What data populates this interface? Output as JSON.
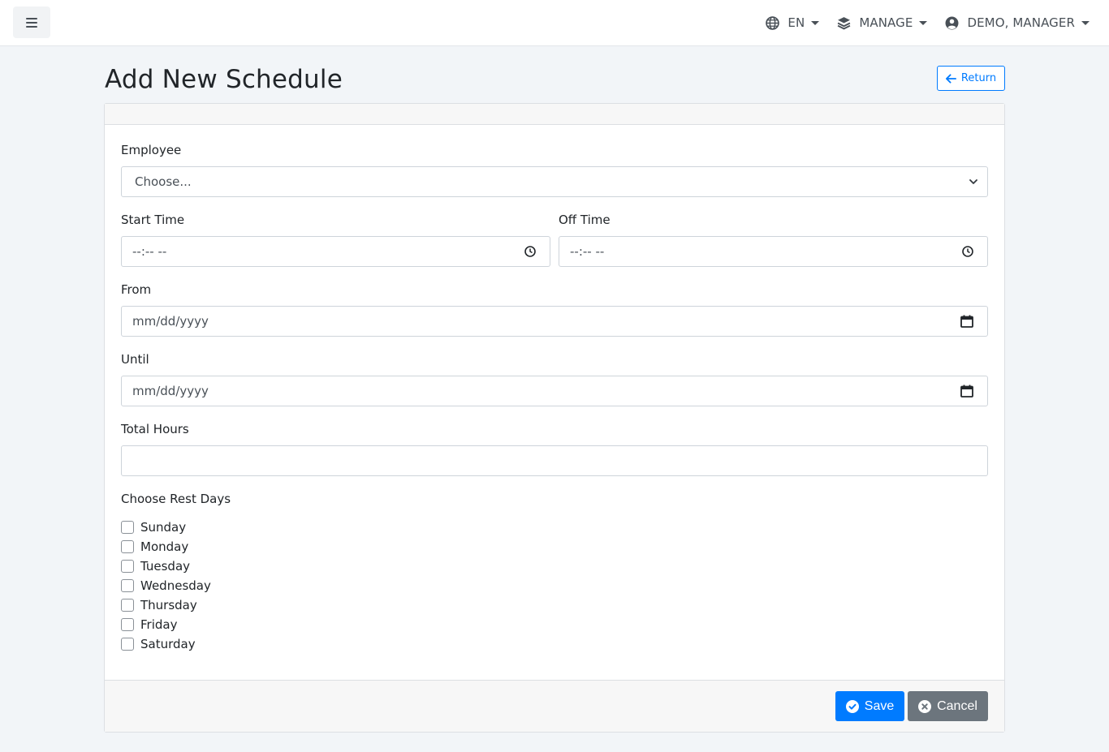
{
  "navbar": {
    "language": "EN",
    "manage": "MANAGE",
    "user": "DEMO, MANAGER"
  },
  "page": {
    "title": "Add New Schedule",
    "return_label": "Return"
  },
  "form": {
    "employee_label": "Employee",
    "employee_value": "Choose...",
    "start_time_label": "Start Time",
    "start_time_value": "--:-- --",
    "off_time_label": "Off Time",
    "off_time_value": "--:-- --",
    "from_label": "From",
    "from_value": "mm/dd/yyyy",
    "until_label": "Until",
    "until_value": "mm/dd/yyyy",
    "total_hours_label": "Total Hours",
    "total_hours_value": "",
    "rest_days_label": "Choose Rest Days",
    "rest_days": [
      {
        "label": "Sunday",
        "checked": false
      },
      {
        "label": "Monday",
        "checked": false
      },
      {
        "label": "Tuesday",
        "checked": false
      },
      {
        "label": "Wednesday",
        "checked": false
      },
      {
        "label": "Thursday",
        "checked": false
      },
      {
        "label": "Friday",
        "checked": false
      },
      {
        "label": "Saturday",
        "checked": false
      }
    ]
  },
  "actions": {
    "save_label": "Save",
    "cancel_label": "Cancel"
  },
  "colors": {
    "primary": "#007bff",
    "secondary": "#6c757d",
    "background": "#f2f5f8"
  }
}
